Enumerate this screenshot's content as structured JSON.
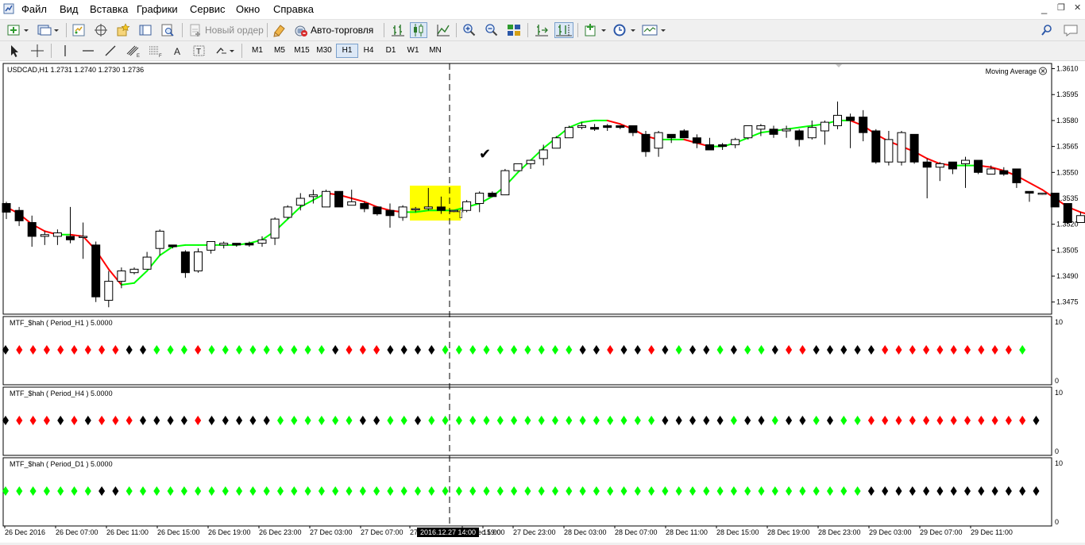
{
  "menu": {
    "items": [
      "Файл",
      "Вид",
      "Вставка",
      "Графики",
      "Сервис",
      "Окно",
      "Справка"
    ],
    "window_controls": [
      "_",
      "❐",
      "✕"
    ]
  },
  "toolbar": {
    "new_order_label": "Новый ордер",
    "autotrading_label": "Авто-торговля",
    "timeframes": [
      "M1",
      "M5",
      "M15",
      "M30",
      "H1",
      "H4",
      "D1",
      "W1",
      "MN"
    ],
    "active_timeframe": "H1"
  },
  "chart": {
    "symbol_header": "USDCAD,H1  1.2731 1.2740 1.2730 1.2736",
    "indicator_name": "Moving Average",
    "price_ticks": [
      "1.3610",
      "1.3595",
      "1.3580",
      "1.3565",
      "1.3550",
      "1.3535",
      "1.3520",
      "1.3505",
      "1.3490",
      "1.3475"
    ],
    "time_ticks": [
      "26 Dec 2016",
      "26 Dec 07:00",
      "26 Dec 11:00",
      "26 Dec 15:00",
      "26 Dec 19:00",
      "26 Dec 23:00",
      "27 Dec 03:00",
      "27 Dec 07:00",
      "27",
      "15:00",
      "27 Dec 19:00",
      "27 Dec 23:00",
      "28 Dec 03:00",
      "28 Dec 07:00",
      "28 Dec 11:00",
      "28 Dec 15:00",
      "28 Dec 19:00",
      "28 Dec 23:00",
      "29 Dec 03:00",
      "29 Dec 07:00",
      "29 Dec 11:00"
    ],
    "crosshair_time": "2016.12.27 14:00",
    "marker_check": "✔",
    "marker_arrow": "⇧"
  },
  "subwindows": [
    {
      "label": "MTF_$hah ( Period_H1 )  5.0000",
      "scale_top": "10",
      "scale_bottom": "0"
    },
    {
      "label": "MTF_$hah ( Period_H4 )  5.0000",
      "scale_top": "10",
      "scale_bottom": "0"
    },
    {
      "label": "MTF_$hah ( Period_D1 )  5.0000",
      "scale_top": "10",
      "scale_bottom": "0"
    }
  ],
  "colors": {
    "up": "#00ff00",
    "down": "#ff0000",
    "neutral": "#000000",
    "highlight": "#ffff00"
  },
  "chart_data": {
    "type": "candlestick",
    "symbol": "USDCAD",
    "timeframe": "H1",
    "ylim": [
      1.3468,
      1.3613
    ],
    "candles_ohlc": [
      [
        1.3532,
        1.3533,
        1.3523,
        1.3527
      ],
      [
        1.3528,
        1.353,
        1.3519,
        1.3522
      ],
      [
        1.3521,
        1.3525,
        1.3507,
        1.3513
      ],
      [
        1.3513,
        1.3516,
        1.3508,
        1.3514
      ],
      [
        1.3513,
        1.3517,
        1.3508,
        1.3515
      ],
      [
        1.3513,
        1.353,
        1.3509,
        1.3511
      ],
      [
        1.3513,
        1.3521,
        1.35,
        1.3513
      ],
      [
        1.3508,
        1.351,
        1.3475,
        1.3478
      ],
      [
        1.3476,
        1.3493,
        1.3472,
        1.3487
      ],
      [
        1.3487,
        1.3495,
        1.3483,
        1.3493
      ],
      [
        1.3492,
        1.3495,
        1.3491,
        1.3494
      ],
      [
        1.3494,
        1.3504,
        1.3494,
        1.3501
      ],
      [
        1.3506,
        1.3517,
        1.3502,
        1.3516
      ],
      [
        1.3508,
        1.3508,
        1.3506,
        1.3507
      ],
      [
        1.3504,
        1.3505,
        1.3489,
        1.3492
      ],
      [
        1.3493,
        1.3506,
        1.3492,
        1.3504
      ],
      [
        1.3505,
        1.351,
        1.3503,
        1.351
      ],
      [
        1.3508,
        1.351,
        1.3506,
        1.3509
      ],
      [
        1.3509,
        1.3509,
        1.3507,
        1.3508
      ],
      [
        1.3509,
        1.351,
        1.3507,
        1.3508
      ],
      [
        1.3509,
        1.3513,
        1.3507,
        1.3511
      ],
      [
        1.3512,
        1.3524,
        1.3508,
        1.3523
      ],
      [
        1.3524,
        1.3531,
        1.3523,
        1.353
      ],
      [
        1.3531,
        1.3538,
        1.3528,
        1.3535
      ],
      [
        1.3536,
        1.354,
        1.3532,
        1.3537
      ],
      [
        1.353,
        1.354,
        1.353,
        1.3539
      ],
      [
        1.3539,
        1.3539,
        1.353,
        1.353
      ],
      [
        1.3531,
        1.354,
        1.3531,
        1.3533
      ],
      [
        1.3532,
        1.3533,
        1.3527,
        1.3529
      ],
      [
        1.353,
        1.353,
        1.3525,
        1.3526
      ],
      [
        1.3528,
        1.3532,
        1.3518,
        1.3525
      ],
      [
        1.3524,
        1.3531,
        1.3522,
        1.353
      ],
      [
        1.3529,
        1.353,
        1.3527,
        1.3529
      ],
      [
        1.3529,
        1.3541,
        1.3528,
        1.353
      ],
      [
        1.353,
        1.3536,
        1.3526,
        1.3528
      ],
      [
        1.3528,
        1.3528,
        1.3527,
        1.3528
      ],
      [
        1.3528,
        1.3534,
        1.3527,
        1.3533
      ],
      [
        1.3532,
        1.3539,
        1.3527,
        1.3538
      ],
      [
        1.3538,
        1.3539,
        1.3536,
        1.3536
      ],
      [
        1.3537,
        1.3552,
        1.3537,
        1.3551
      ],
      [
        1.3551,
        1.3555,
        1.3551,
        1.3555
      ],
      [
        1.3555,
        1.3557,
        1.3552,
        1.3557
      ],
      [
        1.3558,
        1.3566,
        1.3554,
        1.3563
      ],
      [
        1.3564,
        1.3571,
        1.3564,
        1.357
      ],
      [
        1.357,
        1.3577,
        1.357,
        1.3576
      ],
      [
        1.3576,
        1.3579,
        1.3575,
        1.3577
      ],
      [
        1.3576,
        1.3578,
        1.3574,
        1.3575
      ],
      [
        1.3577,
        1.3578,
        1.3574,
        1.3576
      ],
      [
        1.3577,
        1.3577,
        1.3575,
        1.3576
      ],
      [
        1.3577,
        1.3577,
        1.3571,
        1.3573
      ],
      [
        1.3572,
        1.3574,
        1.3559,
        1.3562
      ],
      [
        1.3564,
        1.3574,
        1.3559,
        1.3573
      ],
      [
        1.3572,
        1.3572,
        1.3567,
        1.357
      ],
      [
        1.3574,
        1.3575,
        1.357,
        1.357
      ],
      [
        1.357,
        1.3572,
        1.3564,
        1.3567
      ],
      [
        1.3566,
        1.357,
        1.3563,
        1.3563
      ],
      [
        1.3566,
        1.3567,
        1.3563,
        1.3565
      ],
      [
        1.3566,
        1.357,
        1.3564,
        1.3569
      ],
      [
        1.357,
        1.3577,
        1.3569,
        1.3577
      ],
      [
        1.3575,
        1.3578,
        1.3571,
        1.3577
      ],
      [
        1.3575,
        1.3577,
        1.357,
        1.3572
      ],
      [
        1.3574,
        1.3577,
        1.357,
        1.3575
      ],
      [
        1.3574,
        1.3575,
        1.3565,
        1.3569
      ],
      [
        1.357,
        1.358,
        1.3569,
        1.3576
      ],
      [
        1.3574,
        1.358,
        1.3566,
        1.3579
      ],
      [
        1.3577,
        1.3591,
        1.3575,
        1.3583
      ],
      [
        1.3582,
        1.3584,
        1.3564,
        1.358
      ],
      [
        1.3582,
        1.3586,
        1.3568,
        1.3573
      ],
      [
        1.3574,
        1.3575,
        1.3555,
        1.3556
      ],
      [
        1.3556,
        1.3574,
        1.3554,
        1.3569
      ],
      [
        1.3556,
        1.3574,
        1.3554,
        1.3573
      ],
      [
        1.3572,
        1.3572,
        1.3555,
        1.3556
      ],
      [
        1.3556,
        1.3558,
        1.3535,
        1.3553
      ],
      [
        1.3553,
        1.3556,
        1.3545,
        1.3555
      ],
      [
        1.3556,
        1.3556,
        1.3549,
        1.3552
      ],
      [
        1.3555,
        1.3559,
        1.3541,
        1.3557
      ],
      [
        1.3557,
        1.3557,
        1.3549,
        1.355
      ],
      [
        1.3549,
        1.3554,
        1.3549,
        1.3552
      ],
      [
        1.3551,
        1.3553,
        1.3548,
        1.3549
      ],
      [
        1.3552,
        1.3552,
        1.3541,
        1.3544
      ],
      [
        1.3539,
        1.3539,
        1.3533,
        1.3538
      ],
      [
        1.3538,
        1.3538,
        1.3537,
        1.3538
      ],
      [
        1.3538,
        1.3538,
        1.353,
        1.353
      ],
      [
        1.3532,
        1.3532,
        1.352,
        1.3521
      ],
      [
        1.3521,
        1.3527,
        1.3523,
        1.3525
      ],
      [
        1.3528,
        1.3534,
        1.3521,
        1.3523
      ],
      [
        1.3523,
        1.3527,
        1.3521,
        1.3522
      ],
      [
        1.3523,
        1.3525,
        1.3522,
        1.3524
      ],
      [
        1.3524,
        1.3524,
        1.351,
        1.3513
      ],
      [
        1.3512,
        1.3516,
        1.3506,
        1.3508
      ],
      [
        1.3507,
        1.3511,
        1.3502,
        1.3504
      ],
      [
        1.3504,
        1.3506,
        1.3502,
        1.3505
      ],
      [
        1.3505,
        1.3521,
        1.3505,
        1.3518
      ],
      [
        1.3519,
        1.354,
        1.3519,
        1.3536
      ]
    ],
    "moving_average": {
      "up_color": "#00ff00",
      "down_color": "#ff0000",
      "values": [
        1.353,
        1.3526,
        1.352,
        1.3516,
        1.3514,
        1.3514,
        1.3513,
        1.3505,
        1.3494,
        1.3485,
        1.3486,
        1.3493,
        1.3502,
        1.3507,
        1.3508,
        1.3508,
        1.3508,
        1.3508,
        1.3508,
        1.3509,
        1.3511,
        1.3516,
        1.3523,
        1.353,
        1.3534,
        1.3538,
        1.3537,
        1.3535,
        1.3533,
        1.353,
        1.3528,
        1.3527,
        1.3527,
        1.3528,
        1.3528,
        1.3528,
        1.353,
        1.3532,
        1.3536,
        1.3542,
        1.355,
        1.3557,
        1.3564,
        1.357,
        1.3576,
        1.3579,
        1.358,
        1.358,
        1.3578,
        1.3575,
        1.3571,
        1.3569,
        1.3569,
        1.3569,
        1.3567,
        1.3565,
        1.3565,
        1.3567,
        1.357,
        1.3573,
        1.3574,
        1.3575,
        1.3576,
        1.3577,
        1.3578,
        1.358,
        1.358,
        1.3577,
        1.3572,
        1.3568,
        1.3565,
        1.3562,
        1.3558,
        1.3555,
        1.3554,
        1.3554,
        1.3554,
        1.3553,
        1.3551,
        1.3548,
        1.3544,
        1.354,
        1.3535,
        1.353,
        1.3527,
        1.3525,
        1.3524,
        1.3523,
        1.3521,
        1.3516,
        1.351,
        1.3506,
        1.3507,
        1.3512
      ]
    },
    "signals": {
      "H1": "KRRRRRRRRKKGGGRGGGGGGGGGKRRRKKKKGGGGGGGGGGKKRKKRKGKKGKGGKRRKKKKKRRRRRRRRRRG",
      "H4": "KRRRKRKRRRKKKKRKKKKKGGGGGGKKGGKGGGGGGGGGGGGGGGGGKKKKKGKKGKKGKGGRRRRRRRRRRRRK",
      "D1": "GGGGGGGKKGGGGGGGGGGGGGGGGGGGGGGGGGGGGGGGGGGGGGGGGGGGGGGGGGGGGGGKKKKKKKKKKKKK"
    }
  }
}
